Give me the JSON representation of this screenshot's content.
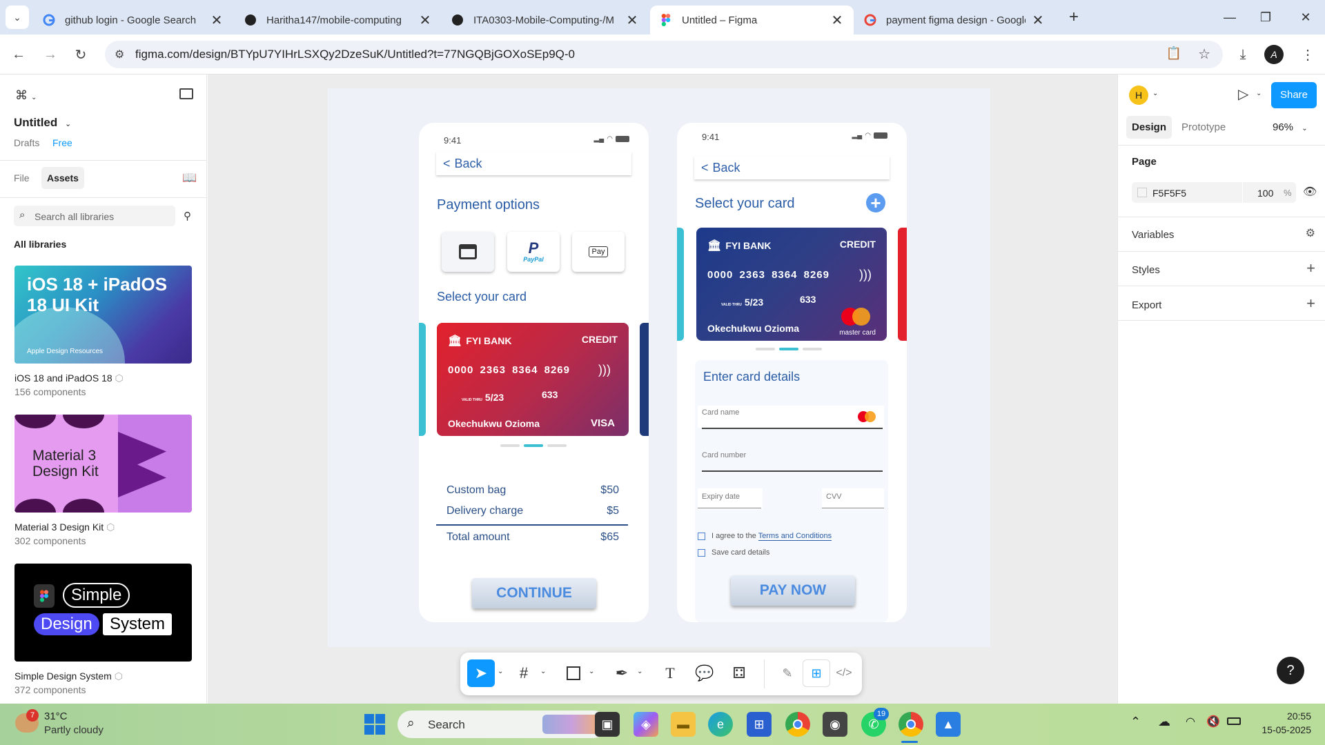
{
  "browser": {
    "tabs": [
      {
        "label": "github login - Google Search",
        "icon": "google-icon",
        "active": false
      },
      {
        "label": "Haritha147/mobile-computing",
        "icon": "github-icon",
        "active": false
      },
      {
        "label": "ITA0303-Mobile-Computing-/M",
        "icon": "github-icon",
        "active": false
      },
      {
        "label": "Untitled – Figma",
        "icon": "figma-icon",
        "active": true
      },
      {
        "label": "payment figma design - Google",
        "icon": "google-icon",
        "active": false
      }
    ],
    "url": "figma.com/design/BTYpU7YIHrLSXQy2DzeSuK/Untitled?t=77NGQBjGOXoSEp9Q-0",
    "profile_initial": "A"
  },
  "left_panel": {
    "file_name": "Untitled",
    "drafts_label": "Drafts",
    "plan_badge": "Free",
    "tab_file": "File",
    "tab_assets": "Assets",
    "search_placeholder": "Search all libraries",
    "section_title": "All libraries",
    "libraries": [
      {
        "thumb_text": "iOS 18 + iPadOS 18 UI Kit",
        "thumb_sub": "Apple Design Resources",
        "title": "iOS 18 and iPadOS 18",
        "count": "156 components"
      },
      {
        "thumb_text": "Material 3 Design Kit",
        "title": "Material 3 Design Kit",
        "count": "302 components"
      },
      {
        "thumb_words": [
          "Simple",
          "Design",
          "System"
        ],
        "title": "Simple Design System",
        "count": "372 components"
      }
    ]
  },
  "phone1": {
    "time": "9:41",
    "back_label": "Back",
    "heading": "Payment options",
    "paypal_label": "PayPal",
    "applepay_label": "Pay",
    "select_card_label": "Select your card",
    "card": {
      "bank": "FYI BANK",
      "type": "CREDIT",
      "number": "0000 2363 8364 8269",
      "expiry": "5/23",
      "expiry_prefix": "VALID THRU",
      "cvv": "633",
      "holder": "Okechukwu Ozioma",
      "brand": "VISA"
    },
    "summary": [
      {
        "label": "Custom bag",
        "amount": "$50"
      },
      {
        "label": "Delivery charge",
        "amount": "$5"
      }
    ],
    "total_label": "Total amount",
    "total_amount": "$65",
    "continue_label": "CONTINUE"
  },
  "phone2": {
    "time": "9:41",
    "back_label": "Back",
    "heading": "Select your card",
    "card": {
      "bank": "FYI BANK",
      "type": "CREDIT",
      "number": "0000 2363 8364 8269",
      "expiry": "5/23",
      "expiry_prefix": "VALID THRU",
      "cvv": "633",
      "holder": "Okechukwu Ozioma",
      "brand": "master card"
    },
    "details_heading": "Enter card details",
    "card_name_label": "Card name",
    "card_number_label": "Card number",
    "expiry_label": "Expiry date",
    "cvv_label": "CVV",
    "terms_prefix": "I agree to the",
    "terms_link": "Terms and Conditions",
    "save_label": "Save card details",
    "pay_label": "PAY NOW"
  },
  "right_panel": {
    "avatar": "H",
    "share_label": "Share",
    "tab_design": "Design",
    "tab_prototype": "Prototype",
    "zoom": "96%",
    "page_label": "Page",
    "page_color": "F5F5F5",
    "page_opacity": "100",
    "opacity_unit": "%",
    "variables_label": "Variables",
    "styles_label": "Styles",
    "export_label": "Export",
    "help_label": "?"
  },
  "taskbar": {
    "temperature": "31°C",
    "weather": "Partly cloudy",
    "weather_badge": "7",
    "search_label": "Search",
    "whatsapp_badge": "19",
    "time": "20:55",
    "date": "15-05-2025"
  },
  "colors": {
    "figma_blue": "#0d99ff",
    "card_red": "#e3212c",
    "card_purple": "#2d3a7a",
    "heading_blue": "#2a5da6",
    "accent_teal": "#3bbfd3"
  }
}
